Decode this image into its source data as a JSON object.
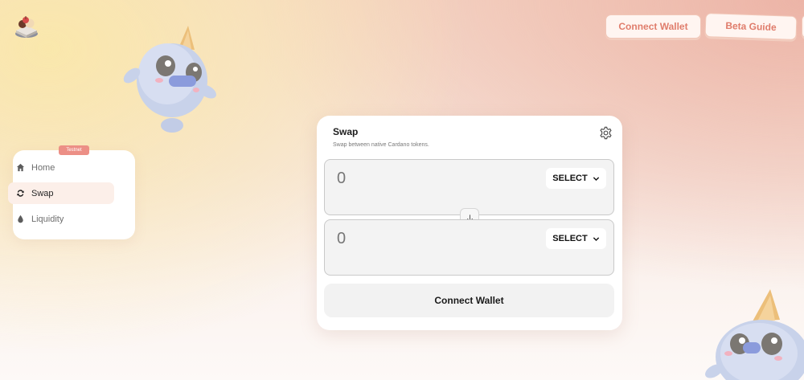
{
  "header": {
    "logo_icon": "ice-cream-logo-icon",
    "connect_wallet_label": "Connect Wallet",
    "beta_guide_label": "Beta Guide"
  },
  "sidebar": {
    "badge": "Testnet",
    "items": [
      {
        "label": "Home",
        "icon": "home-icon",
        "active": false
      },
      {
        "label": "Swap",
        "icon": "swap-arrows-icon",
        "active": true
      },
      {
        "label": "Liquidity",
        "icon": "droplet-icon",
        "active": false
      }
    ]
  },
  "swap": {
    "title": "Swap",
    "subtitle": "Swap between native Cardano tokens.",
    "settings_icon": "gear-icon",
    "from": {
      "amount": "0",
      "select_label": "SELECT"
    },
    "to": {
      "amount": "0",
      "select_label": "SELECT"
    },
    "switch_icon": "arrow-down-icon",
    "connect_label": "Connect Wallet"
  },
  "colors": {
    "accent": "#e07d6c",
    "badge": "#ec8f86",
    "active_nav_bg": "#fcefe9"
  }
}
